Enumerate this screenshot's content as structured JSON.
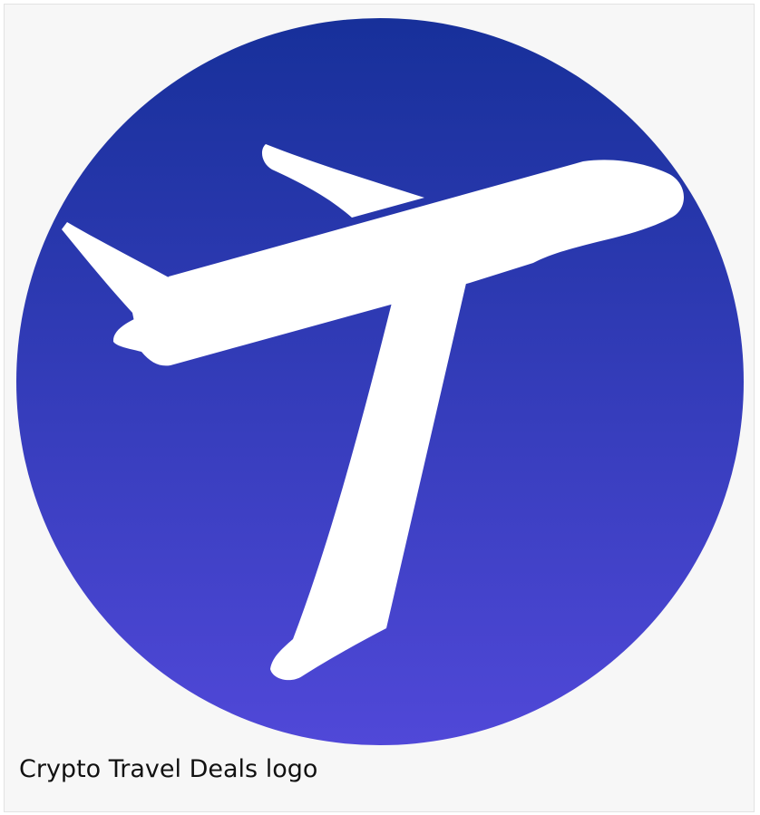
{
  "figure": {
    "caption": "Crypto Travel Deals logo",
    "colors": {
      "gradient_top": "#17309a",
      "gradient_bottom": "#5048d8",
      "plane": "#ffffff",
      "panel_background": "#f7f7f7"
    },
    "icons": [
      "airplane-icon"
    ]
  }
}
